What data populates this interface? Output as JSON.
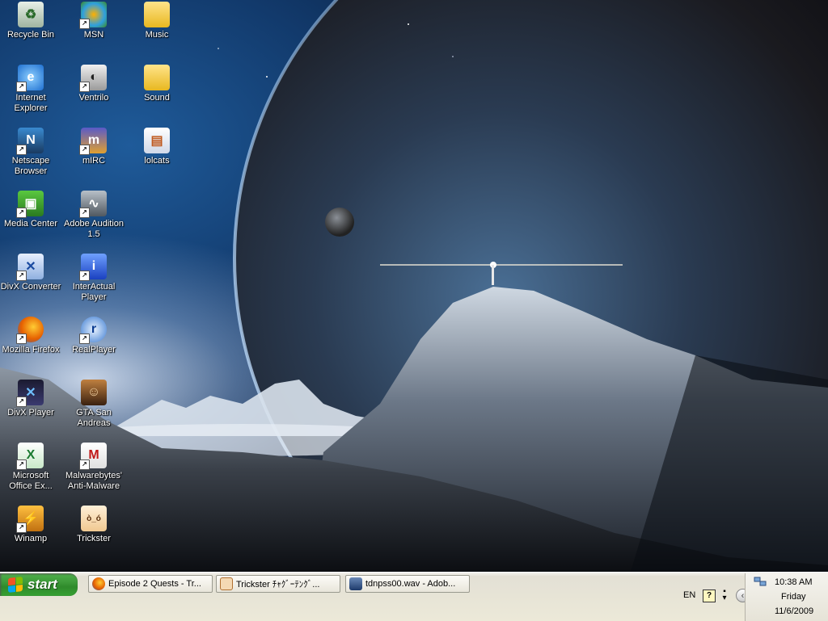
{
  "desktop": {
    "icons": [
      {
        "label": "Recycle Bin",
        "icon": "recycle-bin-icon"
      },
      {
        "label": "MSN",
        "icon": "msn-icon"
      },
      {
        "label": "Music",
        "icon": "folder-icon"
      },
      {
        "label": "Internet Explorer",
        "icon": "internet-explorer-icon"
      },
      {
        "label": "Ventrilo",
        "icon": "ventrilo-icon"
      },
      {
        "label": "Sound",
        "icon": "folder-icon"
      },
      {
        "label": "Netscape Browser",
        "icon": "netscape-icon"
      },
      {
        "label": "mIRC",
        "icon": "mirc-icon"
      },
      {
        "label": "lolcats",
        "icon": "file-icon"
      },
      {
        "label": "Media Center",
        "icon": "media-center-icon"
      },
      {
        "label": "Adobe Audition 1.5",
        "icon": "adobe-audition-icon"
      },
      {
        "label": "DivX Converter",
        "icon": "divx-converter-icon"
      },
      {
        "label": "InterActual Player",
        "icon": "interactual-player-icon"
      },
      {
        "label": "Mozilla Firefox",
        "icon": "firefox-icon"
      },
      {
        "label": "RealPlayer",
        "icon": "realplayer-icon"
      },
      {
        "label": "DivX Player",
        "icon": "divx-player-icon"
      },
      {
        "label": "GTA San Andreas",
        "icon": "gta-icon"
      },
      {
        "label": "Microsoft Office Ex...",
        "icon": "excel-icon"
      },
      {
        "label": "Malwarebytes' Anti-Malware",
        "icon": "malwarebytes-icon"
      },
      {
        "label": "Winamp",
        "icon": "winamp-icon"
      },
      {
        "label": "Trickster",
        "icon": "trickster-icon"
      }
    ]
  },
  "taskbar": {
    "start_label": "start",
    "tasks": [
      {
        "label": "Episode 2 Quests - Tr...",
        "icon": "firefox-icon"
      },
      {
        "label": "Trickster ﾁｬｸﾞｰﾃﾝｸﾞ...",
        "icon": "trickster-icon"
      },
      {
        "label": "tdnpss00.wav - Adob...",
        "icon": "adobe-audition-icon"
      }
    ],
    "language": "EN",
    "help_glyph": "?",
    "clock": {
      "time": "10:38 AM",
      "day": "Friday",
      "date": "11/6/2009"
    }
  },
  "colors": {
    "start_green": "#3d9a39",
    "taskbar_bg": "#ece9d8",
    "wallpaper_sky": "#123a6c"
  }
}
